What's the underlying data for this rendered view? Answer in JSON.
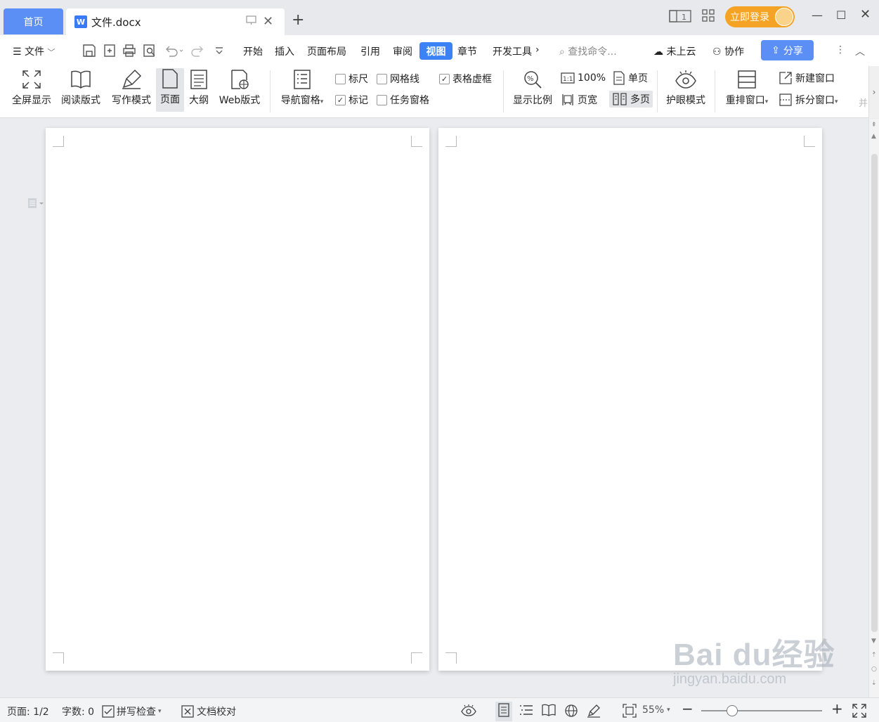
{
  "titlebar": {
    "home_tab": "首页",
    "doc_tab": "文件.docx",
    "doc_icon": "W",
    "login": "立即登录"
  },
  "menubar": {
    "file_label": "文件",
    "items": [
      "开始",
      "插入",
      "页面布局",
      "引用",
      "审阅",
      "视图",
      "章节",
      "开发工具"
    ],
    "active": "视图",
    "search_placeholder": "查找命令...",
    "cloud": "未上云",
    "collab": "协作",
    "share": "分享"
  },
  "ribbon": {
    "fullscreen": "全屏显示",
    "reading": "阅读版式",
    "writing": "写作模式",
    "page": "页面",
    "outline": "大纲",
    "web": "Web版式",
    "nav_pane": "导航窗格",
    "checks": {
      "ruler": "标尺",
      "gridlines": "网格线",
      "table_borders": "表格虚框",
      "marks": "标记",
      "task_pane": "任务窗格"
    },
    "zoom_ratio": "显示比例",
    "zoom_100": "100%",
    "single_page": "单页",
    "page_width": "页宽",
    "multi_page": "多页",
    "eye_mode": "护眼模式",
    "arrange": "重排窗口",
    "new_window": "新建窗口",
    "split_window": "拆分窗口",
    "more": "并"
  },
  "status": {
    "page": "页面: 1/2",
    "words": "字数: 0",
    "spell": "拼写检查",
    "proof": "文档校对",
    "zoom": "55%"
  },
  "watermark": {
    "brand": "Bai du经验",
    "url": "jingyan.baidu.com"
  },
  "colors": {
    "accent": "#3b82f6",
    "home_tab": "#5b8ff5",
    "login": "#f4a325"
  }
}
